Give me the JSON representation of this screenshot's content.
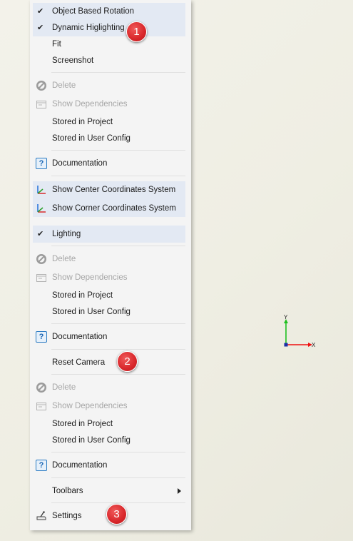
{
  "menu": {
    "object_based_rotation": "Object Based Rotation",
    "dynamic_highlighting": "Dynamic Higlighting",
    "fit": "Fit",
    "screenshot": "Screenshot",
    "delete": "Delete",
    "show_dependencies": "Show Dependencies",
    "stored_in_project": "Stored in Project",
    "stored_in_user_config": "Stored in User Config",
    "documentation": "Documentation",
    "show_center_cs": "Show Center Coordinates System",
    "show_corner_cs": "Show Corner Coordinates System",
    "lighting": "Lighting",
    "reset_camera": "Reset Camera",
    "toolbars": "Toolbars",
    "settings": "Settings"
  },
  "badges": {
    "one": "1",
    "two": "2",
    "three": "3"
  },
  "triad": {
    "y_label": "Y",
    "x_label": "X"
  },
  "icons": {
    "checkmark": "✔",
    "delete": "delete-icon",
    "dependencies": "dependencies-icon",
    "documentation": "?",
    "axes": "axes-icon",
    "settings": "settings-icon"
  },
  "colors": {
    "selected_bg": "#e3e9f3",
    "badge": "#d8262a",
    "disabled_text": "#a6a6a6"
  }
}
